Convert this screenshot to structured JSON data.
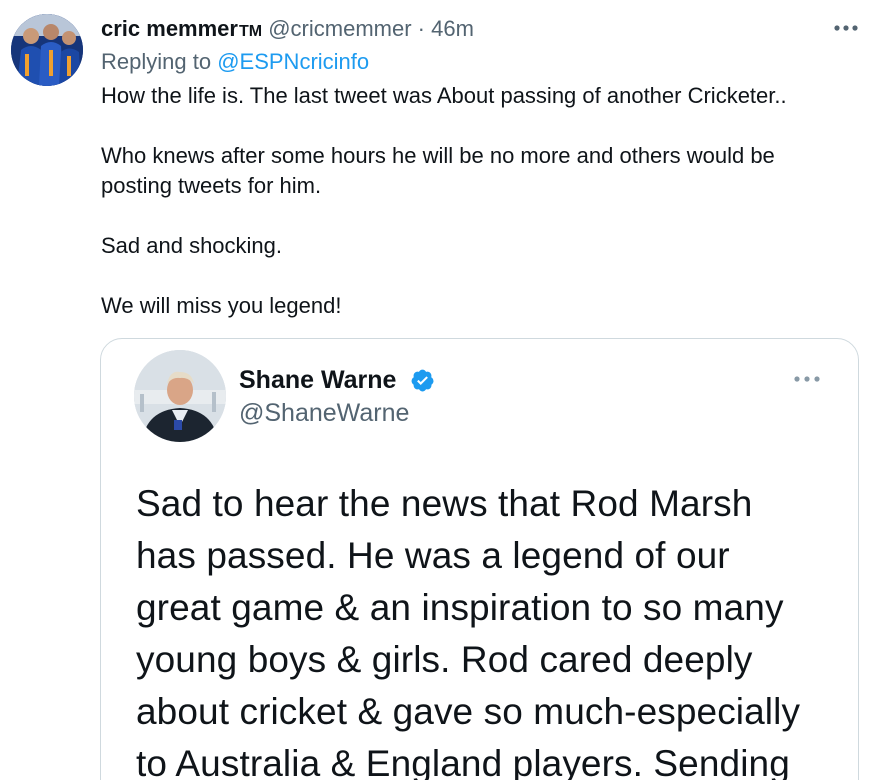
{
  "tweet": {
    "display_name": "cric memmer",
    "name_suffix": "TM",
    "handle": "@cricmemmer",
    "separator": "·",
    "time": "46m",
    "replying_prefix": "Replying to",
    "replying_to": "@ESPNcricinfo",
    "body_lines": [
      "How the life is. The last tweet was About passing of another Cricketer..",
      "Who knews after some hours he will be no more and others would be",
      "posting tweets for him.",
      "Sad and shocking.",
      "We will miss you legend!"
    ],
    "more_icon": "more-horizontal-icon"
  },
  "quoted": {
    "display_name": "Shane Warne",
    "handle": "@ShaneWarne",
    "verified_icon": "verified-badge-icon",
    "more_icon": "more-horizontal-icon",
    "text_lines": [
      "Sad to hear the news that Rod Marsh",
      "has passed. He was a legend of our",
      "great game & an inspiration to so many",
      "young boys &  girls. Rod cared deeply",
      "about cricket & gave so much-especially",
      "to Australia & England players. Sending"
    ]
  },
  "colors": {
    "text_primary": "#0f1419",
    "text_secondary": "#536471",
    "link": "#1d9bf0",
    "verified": "#1d9bf0",
    "card_border": "#cfd9de"
  }
}
